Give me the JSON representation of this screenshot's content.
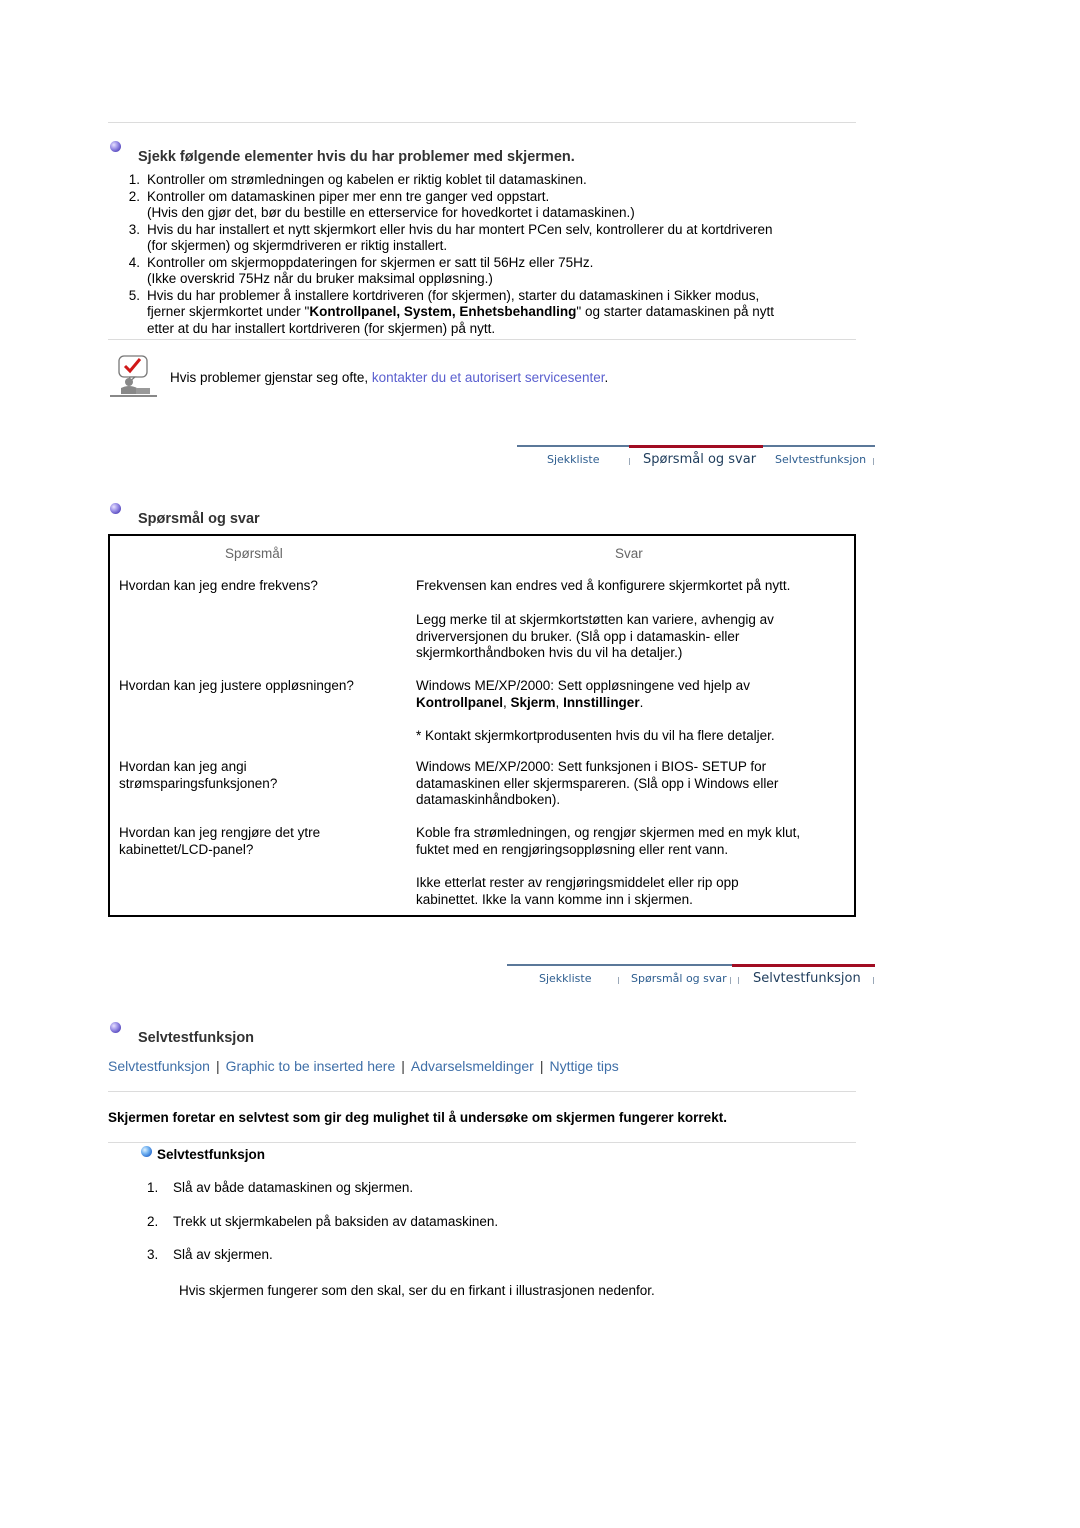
{
  "checklist": {
    "heading": "Sjekk følgende elementer hvis du har problemer med skjermen.",
    "items": [
      {
        "num": "1.",
        "lines": [
          "Kontroller om strømledningen og kabelen er riktig koblet til datamaskinen."
        ]
      },
      {
        "num": "2.",
        "lines": [
          "Kontroller om datamaskinen piper mer enn tre ganger ved oppstart.",
          "(Hvis den gjør det, bør du bestille en etterservice for hovedkortet i datamaskinen.)"
        ]
      },
      {
        "num": "3.",
        "lines": [
          "Hvis du har installert et nytt skjermkort eller hvis du har montert PCen selv, kontrollerer du at kortdriveren",
          "(for skjermen) og skjermdriveren er riktig installert."
        ]
      },
      {
        "num": "4.",
        "lines": [
          "Kontroller om skjermoppdateringen for skjermen er satt til 56Hz eller 75Hz.",
          "(Ikke overskrid 75Hz når du bruker maksimal oppløsning.)"
        ]
      },
      {
        "num": "5.",
        "line1": "Hvis du har problemer å installere kortdriveren (for skjermen), starter du datamaskinen i Sikker modus,",
        "line2_pre": "fjerner skjermkortet under \"",
        "line2_bold": "Kontrollpanel, System, Enhetsbehandling",
        "line2_post": "\" og starter datamaskinen på nytt",
        "line3": "etter at du har installert kortdriveren (for skjermen) på nytt."
      }
    ],
    "note_text": "Hvis problemer gjenstar seg ofte, ",
    "note_link": "kontakter du et autorisert servicesenter",
    "note_end": "."
  },
  "tabs": {
    "sjekkliste": "Sjekkliste",
    "sporsmal": "Spørsmål og svar",
    "selvtest": "Selvtestfunksjon"
  },
  "qa": {
    "heading": "Spørsmål og svar",
    "col_question": "Spørsmål",
    "col_answer": "Svar",
    "rows": {
      "r1": {
        "q": [
          "Hvordan kan jeg endre frekvens?"
        ],
        "a1": [
          "Frekvensen kan endres ved å konfigurere skjermkortet på nytt."
        ],
        "a2": [
          "Legg merke til at skjermkortstøtten kan variere, avhengig av",
          "driverversjonen du bruker. (Slå opp i datamaskin- eller",
          "skjermkorthåndboken hvis du vil ha detaljer.)"
        ]
      },
      "r2": {
        "q": [
          "Hvordan kan jeg justere oppløsningen?"
        ],
        "a1_line1": "Windows ME/XP/2000: Sett oppløsningene ved hjelp av",
        "a1_b1": "Kontrollpanel",
        "a1_c1": ", ",
        "a1_b2": "Skjerm",
        "a1_c2": ", ",
        "a1_b3": "Innstillinger",
        "a1_end": ".",
        "a2": [
          "* Kontakt skjermkortprodusenten hvis du vil ha flere detaljer."
        ]
      },
      "r3": {
        "q": [
          "Hvordan kan jeg angi",
          "strømsparingsfunksjonen?"
        ],
        "a1": [
          "Windows ME/XP/2000: Sett funksjonen i BIOS- SETUP for",
          "datamaskinen eller skjermspareren. (Slå opp i Windows eller",
          "datamaskinhåndboken)."
        ]
      },
      "r4": {
        "q": [
          "Hvordan kan jeg rengjøre det ytre",
          "kabinettet/LCD-panel?"
        ],
        "a1": [
          "Koble fra strømledningen, og rengjør skjermen med en myk klut,",
          "fuktet med en rengjøringsoppløsning eller rent vann."
        ],
        "a2": [
          "Ikke etterlat rester av rengjøringsmiddelet eller rip opp",
          "kabinettet. Ikke la vann komme inn i skjermen."
        ]
      }
    }
  },
  "selftest": {
    "heading": "Selvtestfunksjon",
    "links": [
      "Selvtestfunksjon",
      "Graphic to be inserted here",
      "Advarselsmeldinger",
      "Nyttige tips"
    ],
    "link_sep": "|",
    "intro": "Skjermen foretar en selvtest som gir deg mulighet til å undersøke om skjermen fungerer korrekt.",
    "sub_heading": "Selvtestfunksjon",
    "steps": [
      {
        "num": "1.",
        "text": "Slå av både datamaskinen og skjermen."
      },
      {
        "num": "2.",
        "text": "Trekk ut skjermkabelen på baksiden av datamaskinen."
      },
      {
        "num": "3.",
        "text": "Slå av skjermen."
      }
    ],
    "after_steps": "Hvis skjermen fungerer som den skal, ser du en firkant i illustrasjonen nedenfor."
  },
  "colors": {
    "link": "#5a5fcf",
    "tab_text": "#2d5d8f",
    "tab_active_line": "#a10c22"
  }
}
